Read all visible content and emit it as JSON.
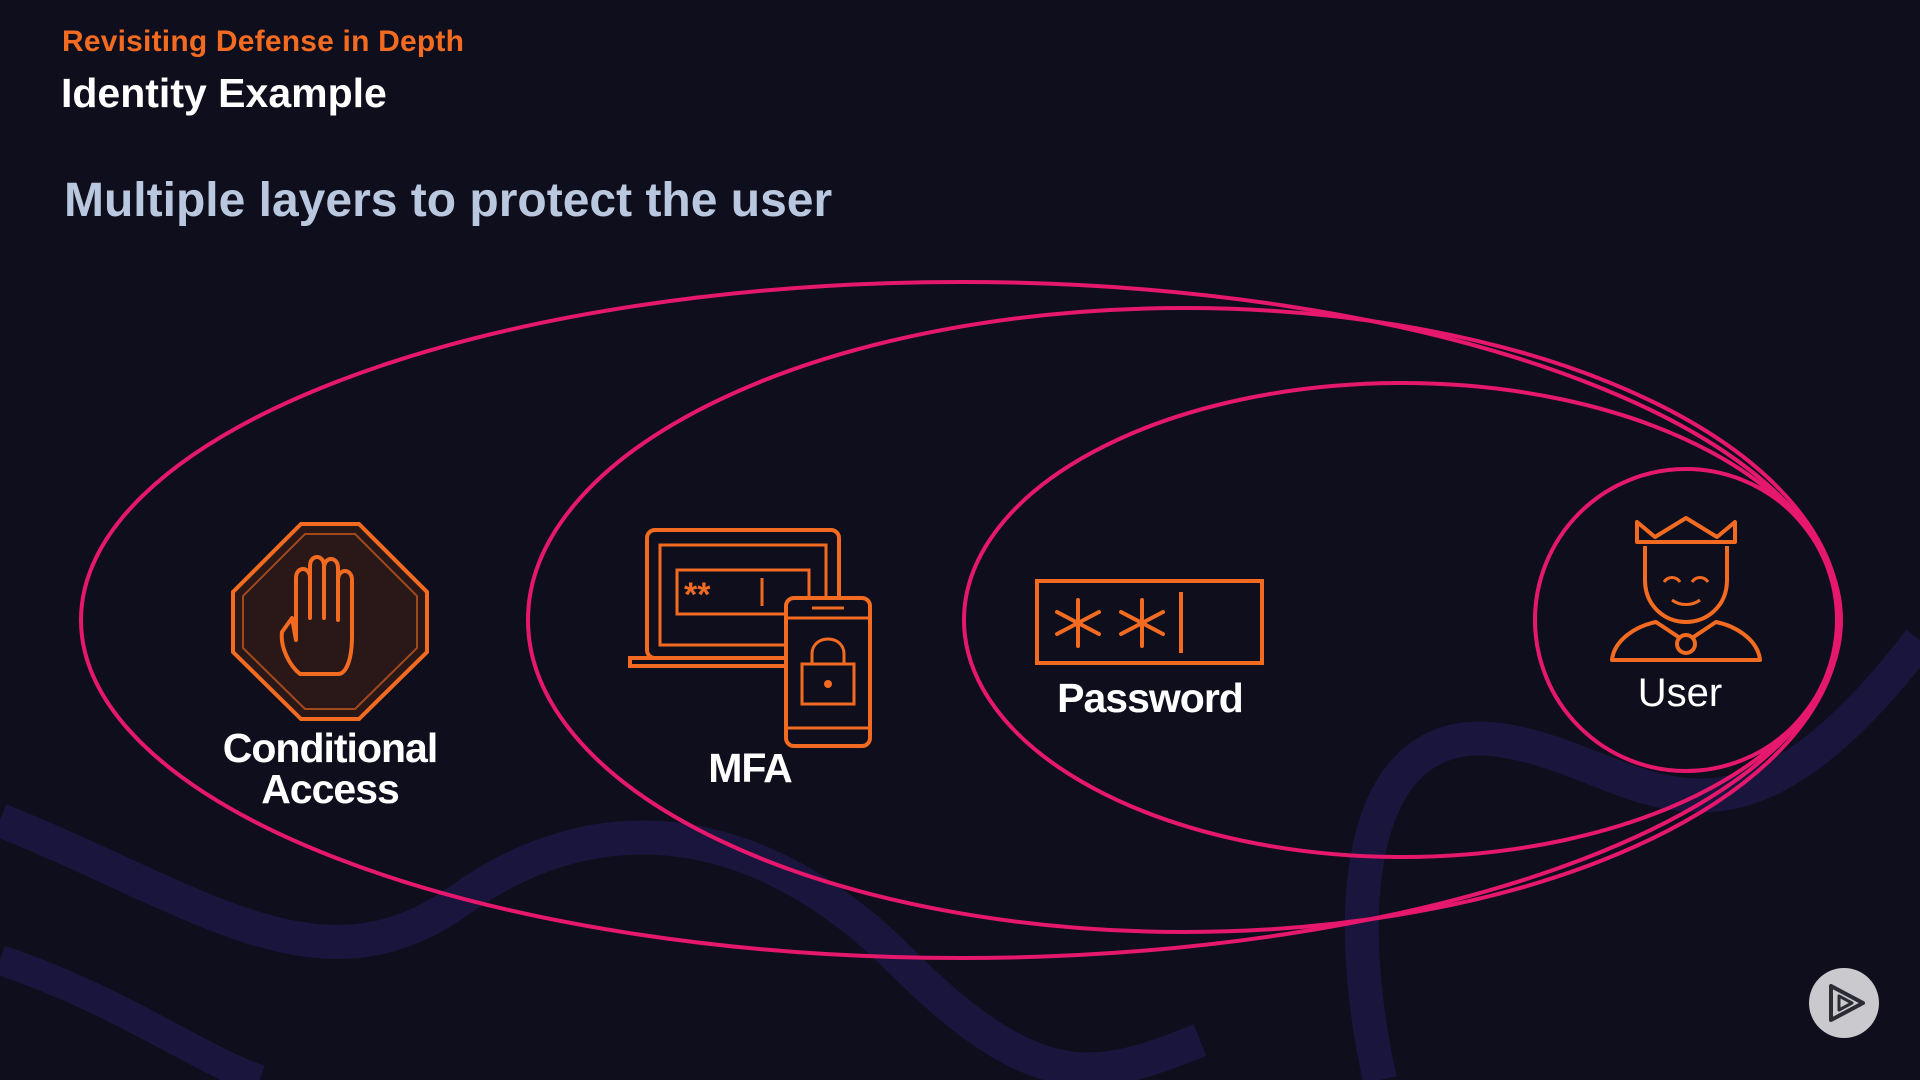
{
  "header": {
    "section_label": "Revisiting Defense in Depth",
    "title": "Identity Example",
    "subtitle": "Multiple layers to protect the user"
  },
  "diagram": {
    "layers": [
      {
        "label": "Conditional Access",
        "icon": "stop-hand-icon"
      },
      {
        "label": "MFA",
        "icon": "laptop-phone-lock-icon"
      },
      {
        "label": "Password",
        "icon": "password-field-icon"
      },
      {
        "label": "User",
        "icon": "crowned-user-icon"
      }
    ]
  },
  "colors": {
    "background": "#0f0e1c",
    "accent_orange": "#f26b21",
    "ring_pink": "#e6186e",
    "subtitle": "#b9c8de"
  },
  "controls": {
    "play_icon": "play-logo-icon"
  }
}
